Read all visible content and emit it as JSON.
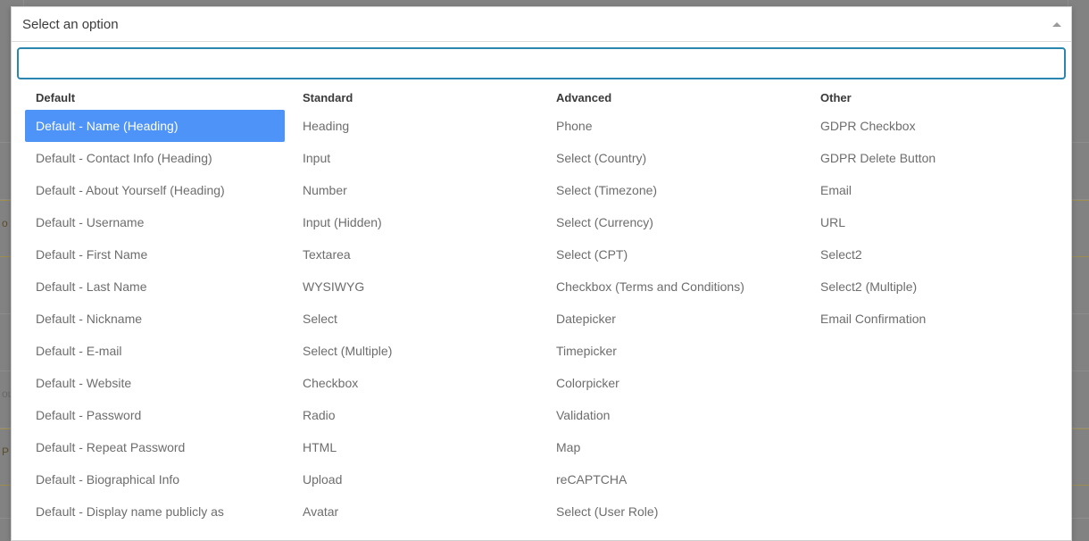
{
  "select": {
    "header_label": "Select an option",
    "caret_icon": "chevron-up-icon",
    "search": {
      "value": "",
      "placeholder": ""
    },
    "highlight_color": "#4e93f7",
    "focus_border_color": "#2a86ae",
    "columns": [
      {
        "title": "Default",
        "items": [
          "Default - Name (Heading)",
          "Default - Contact Info (Heading)",
          "Default - About Yourself (Heading)",
          "Default - Username",
          "Default - First Name",
          "Default - Last Name",
          "Default - Nickname",
          "Default - E-mail",
          "Default - Website",
          "Default - Password",
          "Default - Repeat Password",
          "Default - Biographical Info",
          "Default - Display name publicly as"
        ],
        "selected_index": 0
      },
      {
        "title": "Standard",
        "items": [
          "Heading",
          "Input",
          "Number",
          "Input (Hidden)",
          "Textarea",
          "WYSIWYG",
          "Select",
          "Select (Multiple)",
          "Checkbox",
          "Radio",
          "HTML",
          "Upload",
          "Avatar"
        ],
        "selected_index": -1
      },
      {
        "title": "Advanced",
        "items": [
          "Phone",
          "Select (Country)",
          "Select (Timezone)",
          "Select (Currency)",
          "Select (CPT)",
          "Checkbox (Terms and Conditions)",
          "Datepicker",
          "Timepicker",
          "Colorpicker",
          "Validation",
          "Map",
          "reCAPTCHA",
          "Select (User Role)"
        ],
        "selected_index": -1
      },
      {
        "title": "Other",
        "items": [
          "GDPR Checkbox",
          "GDPR Delete Button",
          "Email",
          "URL",
          "Select2",
          "Select2 (Multiple)",
          "Email Confirmation"
        ],
        "selected_index": -1
      }
    ]
  },
  "background": {
    "stubs": [
      "",
      "",
      "",
      "o",
      "",
      "",
      "",
      "ou",
      "P",
      "",
      ""
    ],
    "accent_rows": [
      3,
      8
    ]
  }
}
